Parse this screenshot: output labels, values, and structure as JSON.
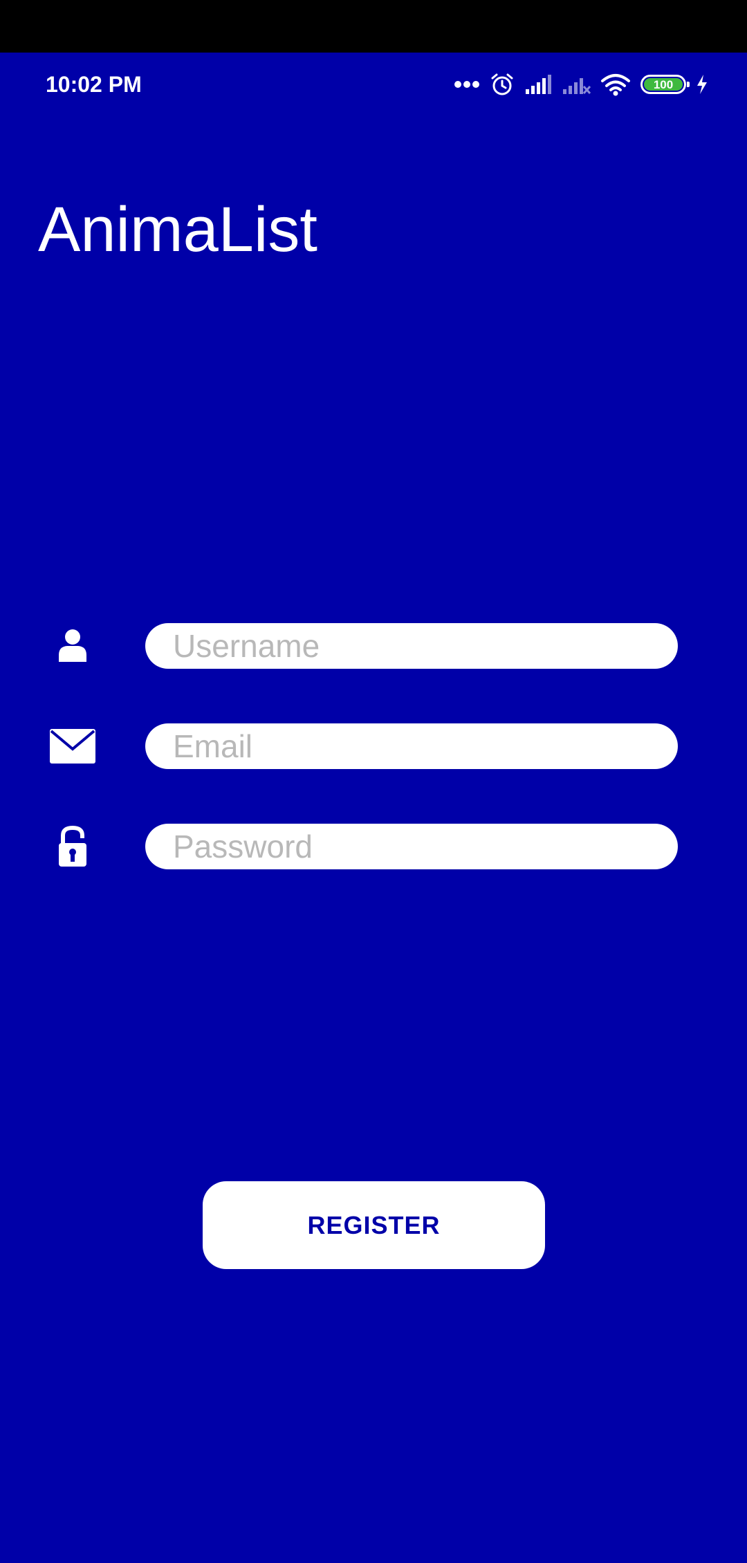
{
  "status_bar": {
    "time": "10:02 PM",
    "battery_level": "100",
    "icons": [
      "more-dots-icon",
      "alarm-icon",
      "signal-icon",
      "signal-no-service-icon",
      "wifi-icon",
      "battery-icon",
      "charging-icon"
    ]
  },
  "app": {
    "title": "AnimaList"
  },
  "form": {
    "username_placeholder": "Username",
    "username_value": "",
    "email_placeholder": "Email",
    "email_value": "",
    "password_placeholder": "Password",
    "password_value": "",
    "register_label": "REGISTER"
  },
  "colors": {
    "background": "#0000A8",
    "accent_text": "#0000A8",
    "field_background": "#FFFFFF",
    "placeholder": "#B8B8B8",
    "battery_fill": "#3FB93F"
  }
}
